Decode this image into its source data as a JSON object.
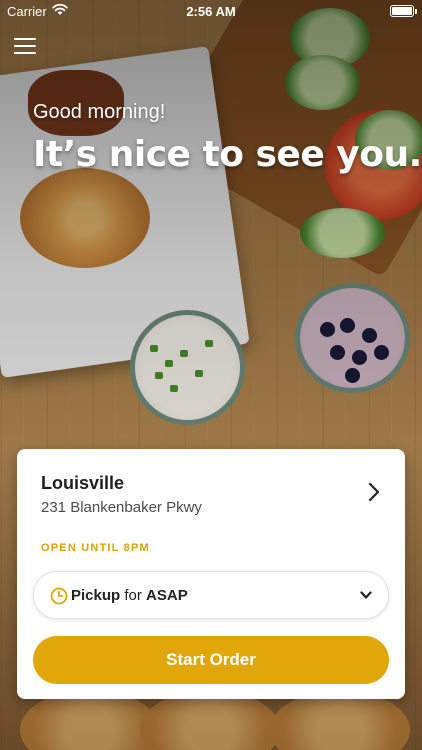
{
  "status_bar": {
    "carrier": "Carrier",
    "time": "2:56 AM"
  },
  "header": {
    "greeting": "Good morning!",
    "welcome": "It’s nice to see you."
  },
  "location_card": {
    "name": "Louisville",
    "address": "231 Blankenbaker Pkwy",
    "hours": "OPEN UNTIL 8PM",
    "order_mode": {
      "type": "Pickup",
      "connector": "for",
      "when": "ASAP"
    },
    "start_button_label": "Start Order"
  },
  "icons": {
    "menu": "hamburger-menu-icon",
    "wifi": "wifi-icon",
    "battery": "battery-icon",
    "chevron": "chevron-right-icon",
    "clock": "clock-icon",
    "dropdown": "chevron-down-icon"
  },
  "colors": {
    "accent": "#e1a709",
    "hours_text": "#d8a400",
    "card_bg": "#ffffff",
    "title_text": "#1f1f1f"
  }
}
